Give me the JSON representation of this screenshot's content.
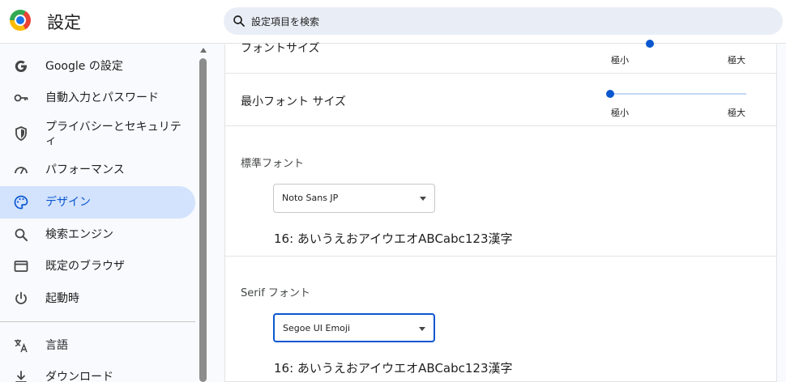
{
  "header": {
    "title": "設定",
    "search_placeholder": "設定項目を検索"
  },
  "sidebar": {
    "items": [
      {
        "label": "Google の設定",
        "icon": "google-g-icon",
        "active": false
      },
      {
        "label": "自動入力とパスワード",
        "icon": "key-icon",
        "active": false
      },
      {
        "label": "プライバシーとセキュリティ",
        "icon": "shield-icon",
        "active": false
      },
      {
        "label": "パフォーマンス",
        "icon": "speedometer-icon",
        "active": false
      },
      {
        "label": "デザイン",
        "icon": "palette-icon",
        "active": true
      },
      {
        "label": "検索エンジン",
        "icon": "search-icon",
        "active": false
      },
      {
        "label": "既定のブラウザ",
        "icon": "browser-window-icon",
        "active": false
      },
      {
        "label": "起動時",
        "icon": "power-icon",
        "active": false
      },
      {
        "label": "言語",
        "icon": "translate-icon",
        "active": false
      },
      {
        "label": "ダウンロード",
        "icon": "download-icon",
        "active": false
      }
    ]
  },
  "main": {
    "font_size": {
      "label": "フォントサイズ",
      "min_label": "極小",
      "max_label": "極大"
    },
    "min_font_size": {
      "label": "最小フォント サイズ",
      "min_label": "極小",
      "max_label": "極大",
      "value_fraction": 0
    },
    "standard_font": {
      "label": "標準フォント",
      "selected": "Noto Sans JP",
      "sample": "16: あいうえおアイウエオABCabc123漢字"
    },
    "serif_font": {
      "label": "Serif フォント",
      "selected": "Segoe UI Emoji",
      "sample": "16: あいうえおアイウエオABCabc123漢字"
    }
  },
  "colors": {
    "accent": "#0b57d0",
    "active_nav_bg": "#d3e3fd",
    "search_bg": "#e9eef6"
  }
}
